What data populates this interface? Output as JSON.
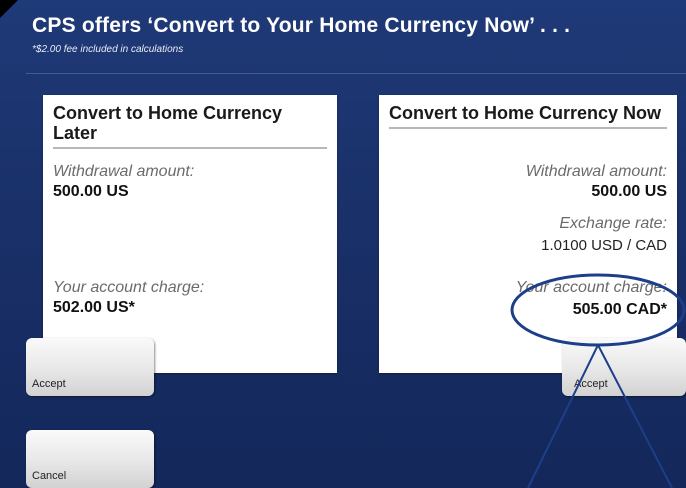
{
  "header": {
    "title": "CPS offers ‘Convert to Your Home Currency Now’ . . .",
    "note": "*$2.00 fee included in calculations"
  },
  "left_panel": {
    "title": "Convert to Home Currency Later",
    "withdrawal_label": "Withdrawal amount:",
    "withdrawal_value": "500.00 US",
    "charge_label": "Your account charge:",
    "charge_value": "502.00 US*"
  },
  "right_panel": {
    "title": "Convert to Home Currency Now",
    "withdrawal_label": "Withdrawal amount:",
    "withdrawal_value": "500.00 US",
    "rate_label": "Exchange rate:",
    "rate_value": "1.0100  USD / CAD",
    "charge_label": "Your account charge:",
    "charge_value": "505.00 CAD*"
  },
  "buttons": {
    "accept_left": "Accept",
    "accept_right": "Accept",
    "cancel": "Cancel"
  },
  "colors": {
    "background": "#1a316a",
    "annotation": "#1d3f8a"
  }
}
